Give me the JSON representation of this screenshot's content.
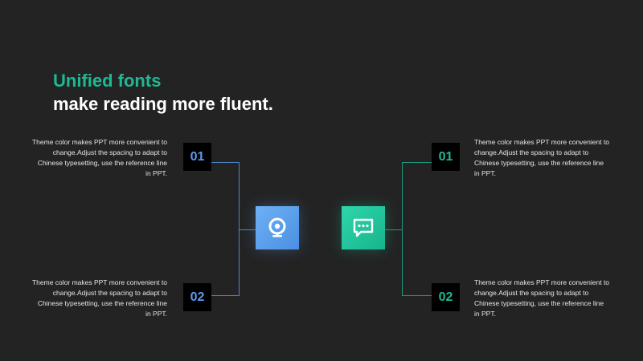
{
  "titles": {
    "line1": "Unified fonts",
    "line2": "make reading more fluent."
  },
  "left": {
    "items": [
      {
        "number": "01",
        "text": "Theme  color makes PPT more convenient to change.Adjust the spacing to adapt to Chinese typesetting, use the reference line in PPT."
      },
      {
        "number": "02",
        "text": "Theme  color makes PPT more convenient to change.Adjust the spacing to adapt to Chinese typesetting, use the reference line in PPT."
      }
    ]
  },
  "right": {
    "items": [
      {
        "number": "01",
        "text": "Theme  color makes PPT more convenient to change.Adjust the spacing to adapt to Chinese typesetting, use the reference line in PPT."
      },
      {
        "number": "02",
        "text": "Theme  color makes PPT more convenient to change.Adjust the spacing to adapt to Chinese typesetting, use the reference line in PPT."
      }
    ]
  },
  "icons": {
    "left": "webcam-icon",
    "right": "chat-bubble-icon"
  },
  "colors": {
    "background": "#232323",
    "accent_green": "#1fb894",
    "accent_blue": "#5b9bea",
    "title_white": "#ffffff"
  }
}
